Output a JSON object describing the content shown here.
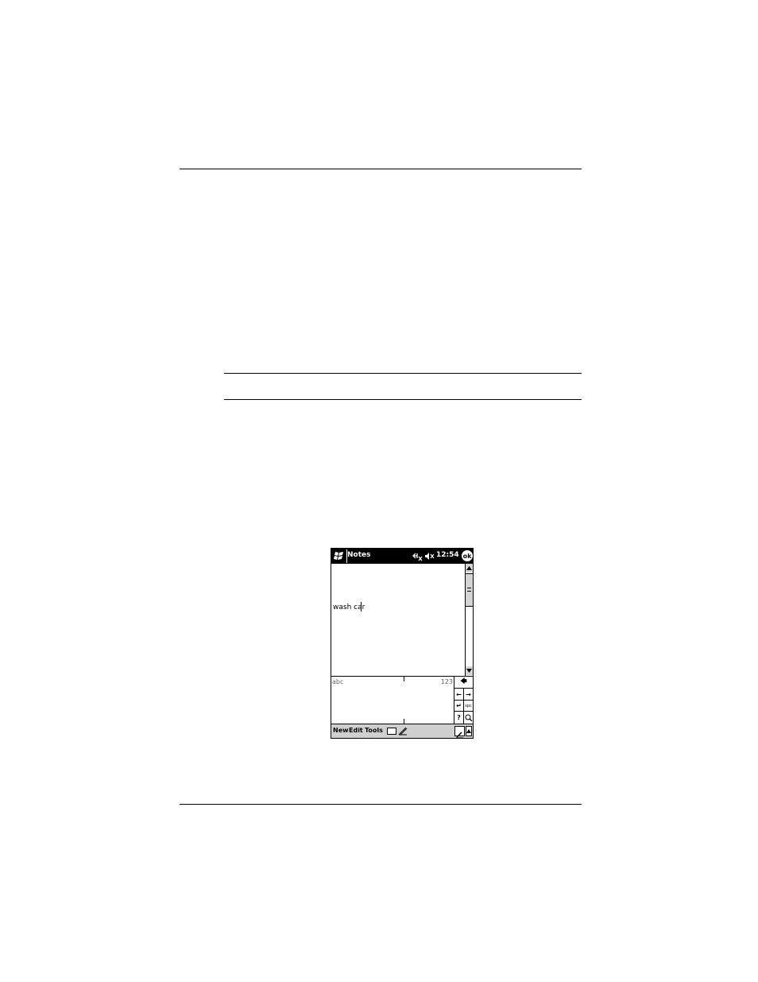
{
  "device": {
    "title_bar": {
      "start_icon": "windows-flag-icon",
      "app_title": "Notes",
      "connection_icon": "connectivity-icon",
      "volume_icon": "speaker-mute-icon",
      "time": "12:54",
      "ok_label": "ok"
    },
    "note": {
      "text": "wash car"
    },
    "handwriting_panel": {
      "left_label": "abc",
      "right_label": "123",
      "keys": {
        "backspace": "🡄",
        "left": "←",
        "right": "→",
        "enter": "↵",
        "space": "spc",
        "help": "?",
        "zoom": "zoom-icon"
      }
    },
    "menu_bar": {
      "items": [
        "New",
        "Edit",
        "Tools"
      ],
      "keyboard_icon": "keyboard-icon",
      "pen_icon": "pen-icon",
      "input_icon": "input-panel-icon",
      "input_arrow_icon": "chevron-up-icon"
    }
  }
}
